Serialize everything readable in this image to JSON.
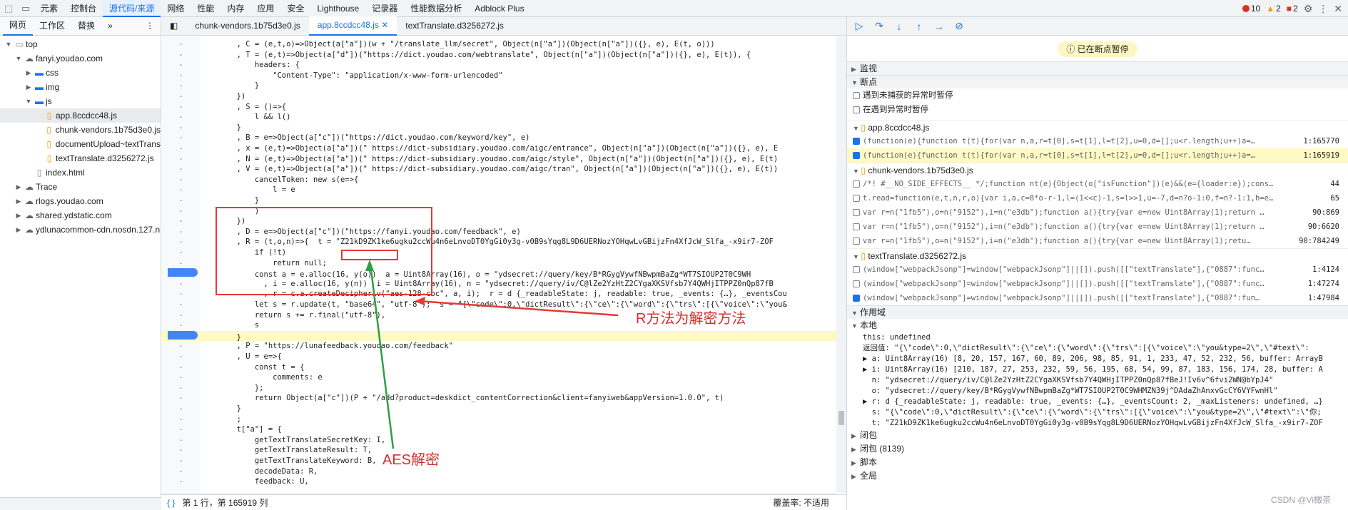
{
  "topbar": {
    "tabs": [
      "元素",
      "控制台",
      "源代码/来源",
      "网络",
      "性能",
      "内存",
      "应用",
      "安全",
      "Lighthouse",
      "记录器",
      "性能数据分析",
      "Adblock Plus"
    ],
    "errors": "10",
    "warnings": "2",
    "issues": "2"
  },
  "left": {
    "subtabs": [
      "网页",
      "工作区",
      "替换"
    ],
    "tree": [
      {
        "label": "top",
        "indent": 0,
        "icon": "frame",
        "arrow": "▼"
      },
      {
        "label": "fanyi.youdao.com",
        "indent": 1,
        "icon": "cloud",
        "arrow": "▼"
      },
      {
        "label": "css",
        "indent": 2,
        "icon": "folder",
        "arrow": "▶"
      },
      {
        "label": "img",
        "indent": 2,
        "icon": "folder",
        "arrow": "▶"
      },
      {
        "label": "js",
        "indent": 2,
        "icon": "folder",
        "arrow": "▼"
      },
      {
        "label": "app.8ccdcc48.js",
        "indent": 3,
        "icon": "file",
        "arrow": "",
        "sel": true
      },
      {
        "label": "chunk-vendors.1b75d3e0.js",
        "indent": 3,
        "icon": "file",
        "arrow": ""
      },
      {
        "label": "documentUpload~textTrans",
        "indent": 3,
        "icon": "file",
        "arrow": ""
      },
      {
        "label": "textTranslate.d3256272.js",
        "indent": 3,
        "icon": "file",
        "arrow": ""
      },
      {
        "label": "index.html",
        "indent": 2,
        "icon": "file2",
        "arrow": ""
      },
      {
        "label": "Trace",
        "indent": 1,
        "icon": "cloud",
        "arrow": "▶"
      },
      {
        "label": "rlogs.youdao.com",
        "indent": 1,
        "icon": "cloud",
        "arrow": "▶"
      },
      {
        "label": "shared.ydstatic.com",
        "indent": 1,
        "icon": "cloud",
        "arrow": "▶"
      },
      {
        "label": "ydlunacommon-cdn.nosdn.127.n",
        "indent": 1,
        "icon": "cloud",
        "arrow": "▶"
      }
    ]
  },
  "editor": {
    "tabs": [
      "chunk-vendors.1b75d3e0.js",
      "app.8ccdcc48.js",
      "textTranslate.d3256272.js"
    ],
    "lines": [
      {
        "g": "-",
        "t": "        , C = (e,t,o)=>Object(a[\"a\"])(w + \"/translate_llm/secret\", Object(n[\"a\"])(Object(n[\"a\"])({}, e), E(t, o)))"
      },
      {
        "g": "-",
        "t": "        , T = (e,t)=>Object(a[\"d\"])(\"https://dict.youdao.com/webtranslate\", Object(n[\"a\"])(Object(n[\"a\"])({}, e), E(t)), {"
      },
      {
        "g": "-",
        "t": "            headers: {"
      },
      {
        "g": "-",
        "t": "                \"Content-Type\": \"application/x-www-form-urlencoded\""
      },
      {
        "g": "-",
        "t": "            }"
      },
      {
        "g": "-",
        "t": "        })"
      },
      {
        "g": "-",
        "t": "        , S = ()=>{"
      },
      {
        "g": "-",
        "t": "            l && l()"
      },
      {
        "g": "-",
        "t": "        }"
      },
      {
        "g": "-",
        "t": "        , B = e=>Object(a[\"c\"])(\"https://dict.youdao.com/keyword/key\", e)"
      },
      {
        "g": "-",
        "t": "        , x = (e,t)=>Object(a[\"a\"])(\" https://dict-subsidiary.youdao.com/aigc/entrance\", Object(n[\"a\"])(Object(n[\"a\"])({}, e), E"
      },
      {
        "g": "-",
        "t": "        , N = (e,t)=>Object(a[\"a\"])(\" https://dict-subsidiary.youdao.com/aigc/style\", Object(n[\"a\"])(Object(n[\"a\"])({}, e), E(t)"
      },
      {
        "g": "-",
        "t": "        , V = (e,t)=>Object(a[\"a\"])(\" https://dict-subsidiary.youdao.com/aigc/tran\", Object(n[\"a\"])(Object(n[\"a\"])({}, e), E(t))"
      },
      {
        "g": "-",
        "t": "            cancelToken: new s(e=>{"
      },
      {
        "g": "-",
        "t": "                l = e"
      },
      {
        "g": "-",
        "t": "            }"
      },
      {
        "g": "-",
        "t": "            )"
      },
      {
        "g": "-",
        "t": "        })"
      },
      {
        "g": "-",
        "t": "        , D = e=>Object(a[\"c\"])(\"https://fanyi.youdao.com/feedback\", e)"
      },
      {
        "g": "-",
        "t": "        , R = (t,o,n)=>{  t = \"Z21kD9ZK1ke6ugku2ccWu4n6eLnvoDT0YgGi0y3g-v0B9sYqg8L9D6UERNozYOHqwLvGBijzFn4XfJcW_Slfa_-x9ir7-ZOF"
      },
      {
        "g": "-",
        "t": "            if (!t)"
      },
      {
        "g": "-",
        "t": "                return null;"
      },
      {
        "g": "bp1",
        "t": "            const a = e.alloc(16, y(o))  a = Uint8Array(16), o = \"ydsecret://query/key/B*RGygVywfNBwpmBaZg*WT7SIOUP2T0C9WH"
      },
      {
        "g": "-",
        "t": "              , i = e.alloc(16, y(n))  i = Uint8Array(16), n = \"ydsecret://query/iv/C@lZe2YzHtZ2CYgaXKSVfsb7Y4QWHjITPPZ0nQp87fB"
      },
      {
        "g": "-",
        "t": "              , r = c.a.createDecipheriv(\"aes-128-cbc\", a, i);  r = d {_readableState: j, readable: true, _events: {…}, _eventsCou"
      },
      {
        "g": "-",
        "t": "            let s = r.update(t, \"base64\", \"utf-8\");  s = \"{\\\"code\\\":0,\\\"dictResult\\\":{\\\"ce\\\":{\\\"word\\\":{\\\"trs\\\":[{\\\"voice\\\":\\\"you&"
      },
      {
        "g": "-",
        "t": "            return s += r.final(\"utf-8\"),"
      },
      {
        "g": "-",
        "t": "            s"
      },
      {
        "g": "bp2",
        "t": "        }"
      },
      {
        "g": "-",
        "t": "        , P = \"https://lunafeedback.youdao.com/feedback\""
      },
      {
        "g": "-",
        "t": "        , U = e=>{"
      },
      {
        "g": "-",
        "t": "            const t = {"
      },
      {
        "g": "-",
        "t": "                comments: e"
      },
      {
        "g": "-",
        "t": "            };"
      },
      {
        "g": "-",
        "t": "            return Object(a[\"c\"])(P + \"/add?product=deskdict_contentCorrection&client=fanyiweb&appVersion=1.0.0\", t)"
      },
      {
        "g": "-",
        "t": "        }"
      },
      {
        "g": "-",
        "t": "        ;"
      },
      {
        "g": "-",
        "t": "        t[\"a\"] = {"
      },
      {
        "g": "-",
        "t": "            getTextTranslateSecretKey: I,"
      },
      {
        "g": "-",
        "t": "            getTextTranslateResult: T,"
      },
      {
        "g": "-",
        "t": "            getTextTranslateKeyword: B,"
      },
      {
        "g": "-",
        "t": "            decodeData: R,"
      },
      {
        "g": "-",
        "t": "            feedback: U,"
      }
    ],
    "annotation_decrypt": "R方法为解密方法",
    "annotation_aes": "AES解密",
    "status_position": "第 1 行，第 165919 列",
    "status_coverage": "覆盖率: 不适用"
  },
  "right": {
    "paused": "已在断点暂停",
    "watch": "监视",
    "breakpoints": "断点",
    "pause_uncaught": "遇到未捕获的异常时暂停",
    "pause_caught": "在遇到异常时暂停",
    "files": [
      {
        "name": "app.8ccdcc48.js",
        "rows": [
          {
            "on": true,
            "code": "(function(e){function t(t){for(var n,a,r=t[0],s=t[1],l=t[2],u=0,d=[];u<r.length;u++)a=…",
            "ln": "1:165770",
            "hl": false
          },
          {
            "on": true,
            "code": "(function(e){function t(t){for(var n,a,r=t[0],s=t[1],l=t[2],u=0,d=[];u<r.length;u++)a=…",
            "ln": "1:165919",
            "hl": true
          }
        ]
      },
      {
        "name": "chunk-vendors.1b75d3e0.js",
        "rows": [
          {
            "on": false,
            "code": "/*! #__NO_SIDE_EFFECTS__ */;function nt(e){Object(o[\"isFunction\"])(e)&&(e={loader:e});const…",
            "ln": "44",
            "hl": false
          },
          {
            "on": false,
            "code": "t.read=function(e,t,n,r,o){var i,a,c=8*o-r-1,l=(1<<c)-1,s=l>>1,u=-7,d=n?o-1:0,f=n?-1:1,h=e[…",
            "ln": "65",
            "hl": false
          },
          {
            "on": false,
            "code": "var r=n(\"1fb5\"),o=n(\"9152\"),i=n(\"e3db\");function a(){try{var e=new Uint8Array(1);return …",
            "ln": "90:869",
            "hl": false
          },
          {
            "on": false,
            "code": "var r=n(\"1fb5\"),o=n(\"9152\"),i=n(\"e3db\");function a(){try{var e=new Uint8Array(1);return …",
            "ln": "90:6620",
            "hl": false
          },
          {
            "on": false,
            "code": "var r=n(\"1fb5\"),o=n(\"9152\"),i=n(\"e3db\");function a(){try{var e=new Uint8Array(1);retu…",
            "ln": "90:784249",
            "hl": false
          }
        ]
      },
      {
        "name": "textTranslate.d3256272.js",
        "rows": [
          {
            "on": false,
            "code": "(window[\"webpackJsonp\"]=window[\"webpackJsonp\"]||[]).push([[\"textTranslate\"],{\"0887\":func…",
            "ln": "1:4124",
            "hl": false
          },
          {
            "on": false,
            "code": "(window[\"webpackJsonp\"]=window[\"webpackJsonp\"]||[]).push([[\"textTranslate\"],{\"0887\":func…",
            "ln": "1:47274",
            "hl": false
          },
          {
            "on": true,
            "code": "(window[\"webpackJsonp\"]=window[\"webpackJsonp\"]||[]).push([[\"textTranslate\"],{\"0887\":fun…",
            "ln": "1:47984",
            "hl": false
          }
        ]
      }
    ],
    "scope": "作用域",
    "local": "本地",
    "scope_rows": [
      {
        "t": "this: undefined"
      },
      {
        "t": "返回值: \"{\\\"code\\\":0,\\\"dictResult\\\":{\\\"ce\\\":{\\\"word\\\":{\\\"trs\\\":[{\\\"voice\\\":\\\"you&type=2\\\",\\\"#text\\\":"
      },
      {
        "t": "▶ a: Uint8Array(16) [8, 20, 157, 167, 60, 89, 206, 98, 85, 91, 1, 233, 47, 52, 232, 56, buffer: ArrayB"
      },
      {
        "t": "▶ i: Uint8Array(16) [210, 187, 27, 253, 232, 59, 56, 195, 68, 54, 99, 87, 183, 156, 174, 28, buffer: A"
      },
      {
        "t": "  n: \"ydsecret://query/iv/C@lZe2YzHtZ2CYgaXKSVfsb7Y4QWHjITPPZ0nQp87fBeJ!Iv6v^6fvi2WN@bYpJ4\""
      },
      {
        "t": "  o: \"ydsecret://query/key/B*RGygVywfNBwpmBaZg*WT7SIOUP2T0C9WHMZN39j^DAdaZhAnxvGcCY6VYFwnHl\""
      },
      {
        "t": "▶ r: d {_readableState: j, readable: true, _events: {…}, _eventsCount: 2, _maxListeners: undefined, …}"
      },
      {
        "t": "  s: \"{\\\"code\\\":0,\\\"dictResult\\\":{\\\"ce\\\":{\\\"word\\\":{\\\"trs\\\":[{\\\"voice\\\":\\\"you&type=2\\\",\\\"#text\\\":\\\"你;"
      },
      {
        "t": "  t: \"Z21kD9ZK1ke6ugku2ccWu4n6eLnvoDT0YgGi0y3g-v0B9sYqg8L9D6UERNozYOHqwLvGBijzFn4XfJcW_Slfa_-x9ir7-ZOF"
      }
    ],
    "closure1": "闭包",
    "closure2": "闭包 (8139)",
    "script": "脚本",
    "global": "全局",
    "watermark": "CSDN @Vi橄茶"
  }
}
